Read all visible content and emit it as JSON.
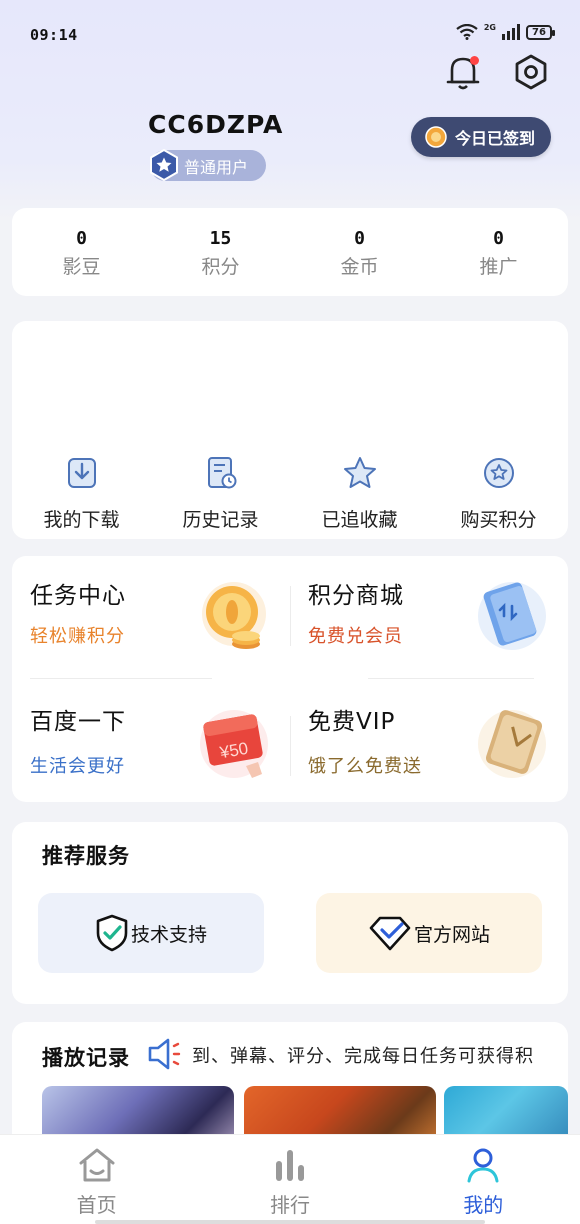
{
  "status_bar": {
    "time": "09:14",
    "network": "2G",
    "battery": "76"
  },
  "header": {
    "username": "CC6DZPA",
    "user_level": "普通用户",
    "checkin_label": "今日已签到",
    "has_notification": true
  },
  "stats": [
    {
      "value": "0",
      "label": "影豆"
    },
    {
      "value": "15",
      "label": "积分"
    },
    {
      "value": "0",
      "label": "金币"
    },
    {
      "value": "0",
      "label": "推广"
    }
  ],
  "shortcuts": [
    {
      "label": "我的下载",
      "icon": "download-icon"
    },
    {
      "label": "历史记录",
      "icon": "history-icon"
    },
    {
      "label": "已追收藏",
      "icon": "star-icon"
    },
    {
      "label": "购买积分",
      "icon": "buy-points-icon"
    }
  ],
  "promos": [
    {
      "title": "任务中心",
      "subtitle": "轻松赚积分",
      "color": "#e8832c"
    },
    {
      "title": "积分商城",
      "subtitle": "免费兑会员",
      "color": "#d8532b"
    },
    {
      "title": "百度一下",
      "subtitle": "生活会更好",
      "color": "#3a70c8"
    },
    {
      "title": "免费VIP",
      "subtitle": "饿了么免费送",
      "color": "#8a6a2e"
    }
  ],
  "coupon_value": "¥50",
  "services": {
    "title": "推荐服务",
    "items": [
      {
        "label": "技术支持",
        "icon": "shield-check-icon",
        "bg": "#edf1fa"
      },
      {
        "label": "官方网站",
        "icon": "diamond-check-icon",
        "bg": "#fdf4e4"
      }
    ]
  },
  "play_history": {
    "title": "播放记录",
    "marquee": "到、弹幕、评分、完成每日任务可获得积"
  },
  "tabs": [
    {
      "label": "首页",
      "icon": "home-icon",
      "active": false
    },
    {
      "label": "排行",
      "icon": "ranking-icon",
      "active": false
    },
    {
      "label": "我的",
      "icon": "profile-icon",
      "active": true
    }
  ],
  "colors": {
    "accent": "#2e5fd9",
    "checkin_bg": "#3e4a72",
    "badge_bg": "#a9b3da"
  }
}
